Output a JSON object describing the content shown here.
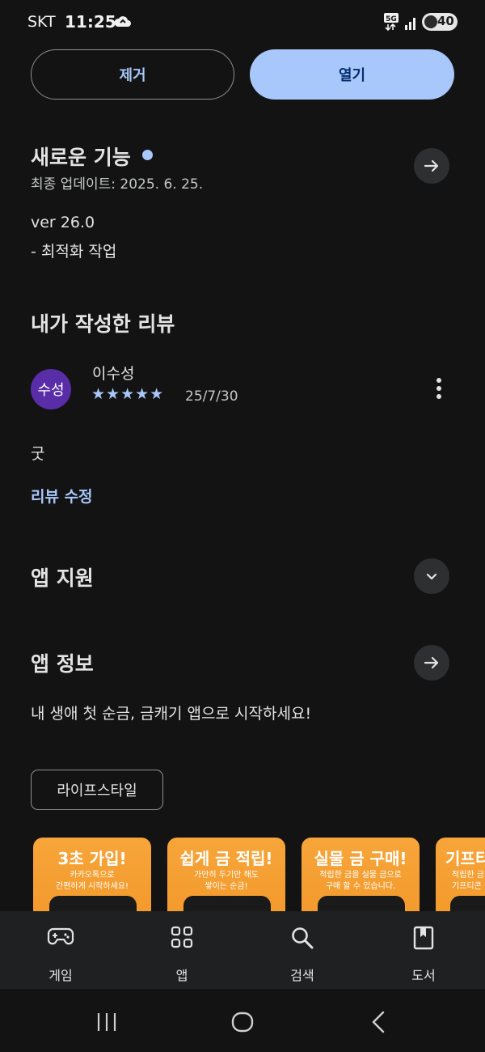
{
  "status_bar": {
    "carrier": "SKT",
    "time": "11:25",
    "network": "5G",
    "battery": "40"
  },
  "actions": {
    "remove_label": "제거",
    "open_label": "열기"
  },
  "whats_new": {
    "title": "새로운 기능",
    "updated": "최종 업데이트: 2025. 6. 25.",
    "version": "ver 26.0",
    "note": "- 최적화 작업"
  },
  "my_review": {
    "title": "내가 작성한 리뷰",
    "avatar_text": "수성",
    "reviewer": "이수성",
    "stars": "★★★★★",
    "rating": 5,
    "date": "25/7/30",
    "text": "굿",
    "edit_label": "리뷰 수정"
  },
  "app_support": {
    "title": "앱 지원"
  },
  "app_info": {
    "title": "앱 정보",
    "description": "내 생애 첫 순금, 금캐기 앱으로 시작하세요!",
    "category_chip": "라이프스타일"
  },
  "screenshots": [
    {
      "title": "3초 가입!",
      "line1": "카카오톡으로",
      "line2": "간편하게 시작하세요!"
    },
    {
      "title": "쉽게 금 적립!",
      "line1": "가만히 두기만 해도",
      "line2": "쌓이는 순금!"
    },
    {
      "title": "실물 금 구매!",
      "line1": "적립한 금을 실물 금으로",
      "line2": "구매 할 수 있습니다."
    },
    {
      "title": "기프티",
      "line1": "적립한 금",
      "line2": "기프티콘"
    }
  ],
  "bottom_nav": [
    {
      "label": "게임",
      "icon": "gamepad-icon"
    },
    {
      "label": "앱",
      "icon": "apps-grid-icon"
    },
    {
      "label": "검색",
      "icon": "search-icon"
    },
    {
      "label": "도서",
      "icon": "book-icon"
    }
  ],
  "colors": {
    "background": "#131314",
    "accent": "#a8c7fa",
    "avatar": "#5a2da8",
    "screenshot_orange": "#f7a53a"
  }
}
